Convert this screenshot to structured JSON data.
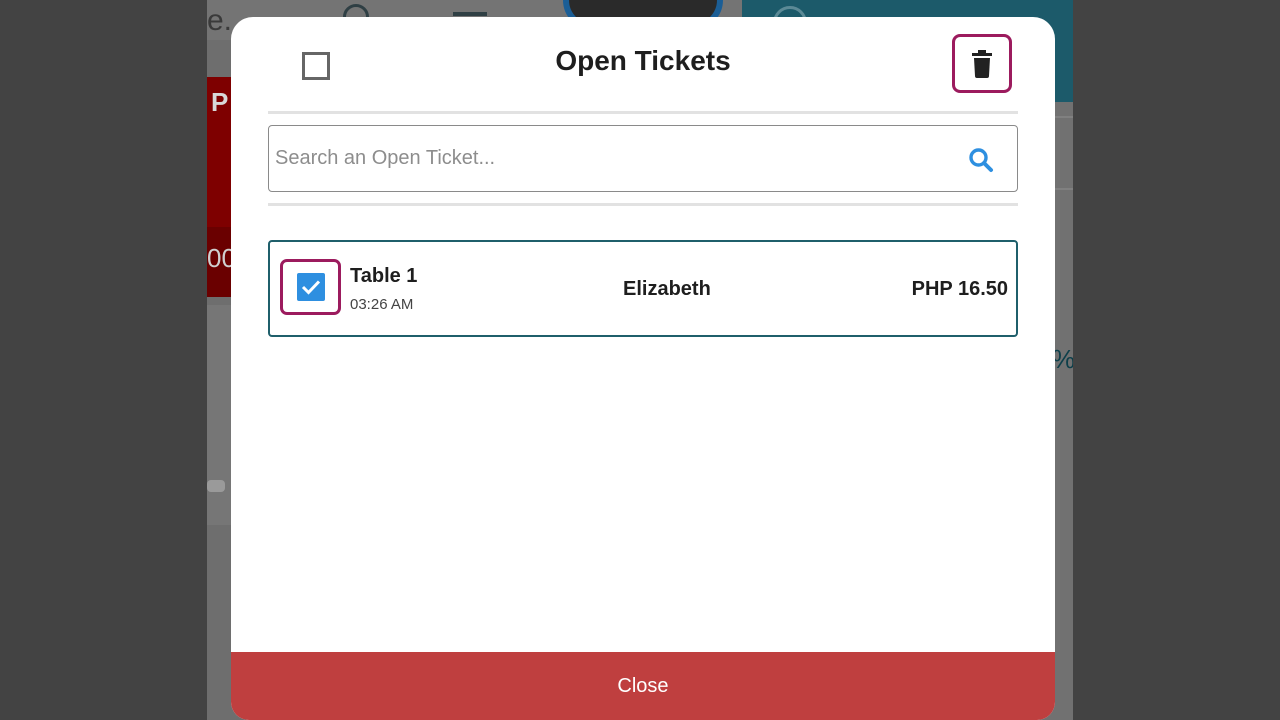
{
  "background": {
    "search_fragment": "e.",
    "red_card_letter": "P",
    "red_card_value": "00,",
    "percent_fragment": "%"
  },
  "modal": {
    "title": "Open Tickets",
    "select_all_icon": "checkbox-unchecked-icon",
    "delete_icon": "trash-icon",
    "search": {
      "placeholder": "Search an Open Ticket...",
      "value": "",
      "icon": "search-icon"
    },
    "tickets": [
      {
        "name": "Table 1",
        "time": "03:26 AM",
        "customer": "Elizabeth",
        "amount": "PHP 16.50",
        "checked": true
      }
    ],
    "close_label": "Close"
  },
  "colors": {
    "accent_highlight": "#9c1b5e",
    "checkbox_blue": "#2e8fe0",
    "search_icon_blue": "#2e8fe0",
    "ticket_border": "#1f5f6b",
    "close_button": "#bf3f3f"
  }
}
